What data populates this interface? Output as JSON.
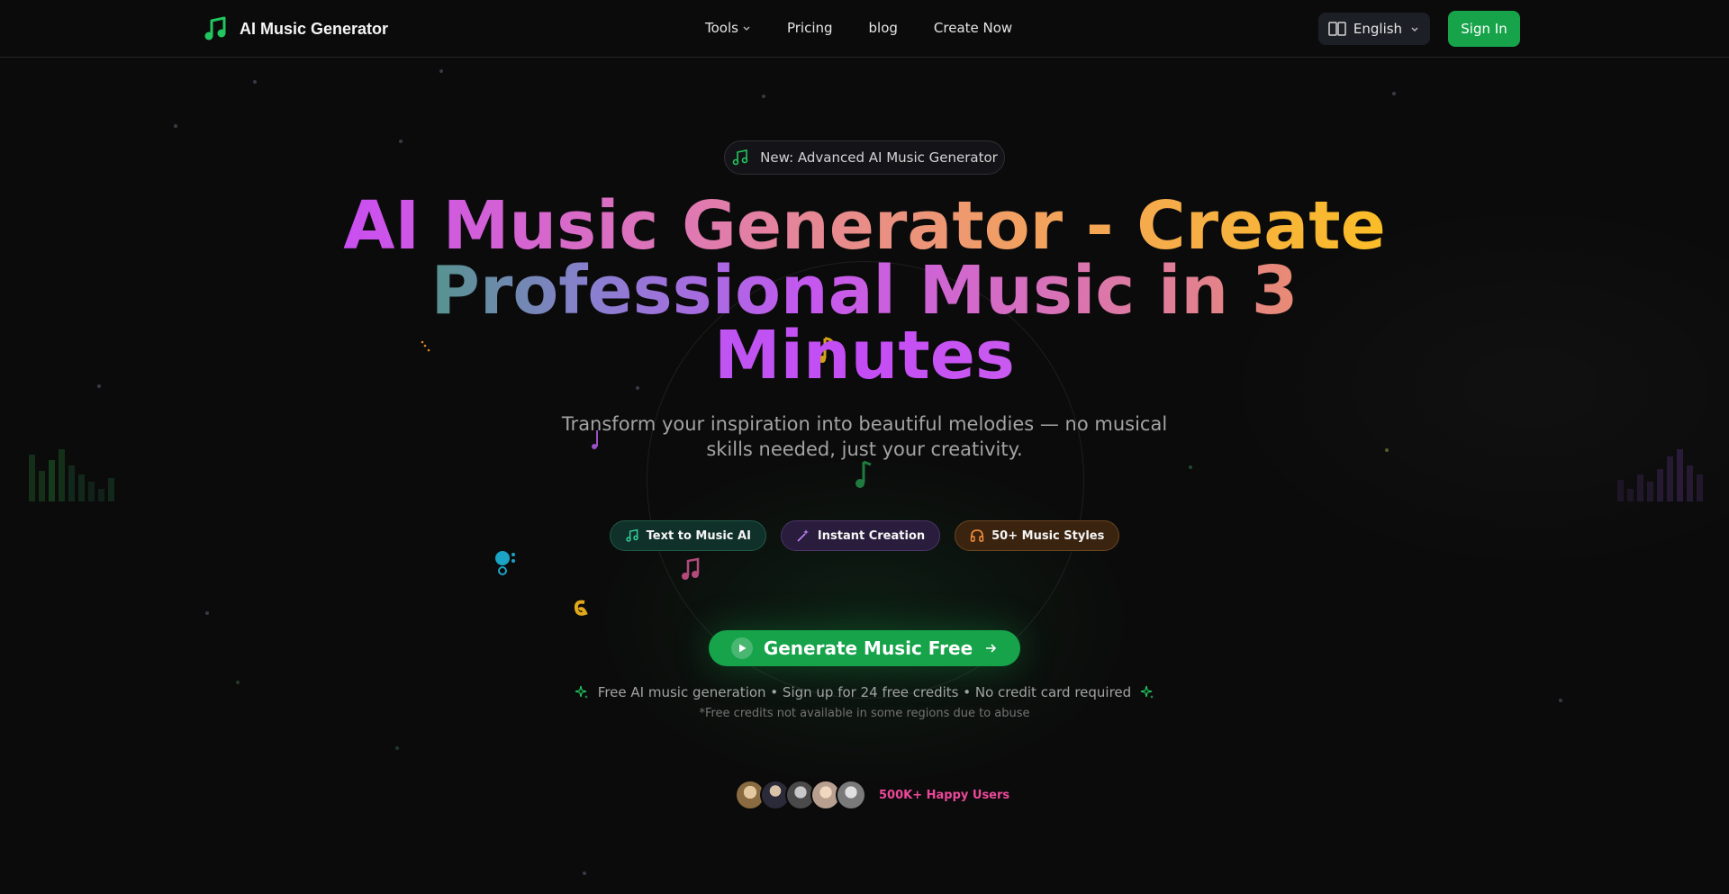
{
  "brand": {
    "name": "AI Music Generator",
    "logo_icon": "music-note-icon",
    "accent": "#16a34a"
  },
  "nav": {
    "links": [
      {
        "label": "Tools",
        "has_dropdown": true
      },
      {
        "label": "Pricing"
      },
      {
        "label": "blog"
      },
      {
        "label": "Create Now"
      }
    ],
    "language": "English",
    "sign_in": "Sign In"
  },
  "hero": {
    "badge": "New: Advanced AI Music Generator",
    "headline": {
      "line1": "AI Music Generator - Create",
      "line2": "Professional Music in 3",
      "line3": "Minutes"
    },
    "subtitle": "Transform your inspiration into beautiful melodies — no musical skills needed, just your creativity.",
    "chips": [
      {
        "label": "Text to Music AI",
        "icon": "music-note-icon"
      },
      {
        "label": "Instant Creation",
        "icon": "magic-wand-icon"
      },
      {
        "label": "50+ Music Styles",
        "icon": "headphones-icon"
      }
    ],
    "cta": "Generate Music Free",
    "free_note": "Free AI music generation • Sign up for 24 free credits • No credit card required",
    "disclaimer": "*Free credits not available in some regions due to abuse"
  },
  "social_proof": {
    "label": "500K+ Happy Users"
  }
}
